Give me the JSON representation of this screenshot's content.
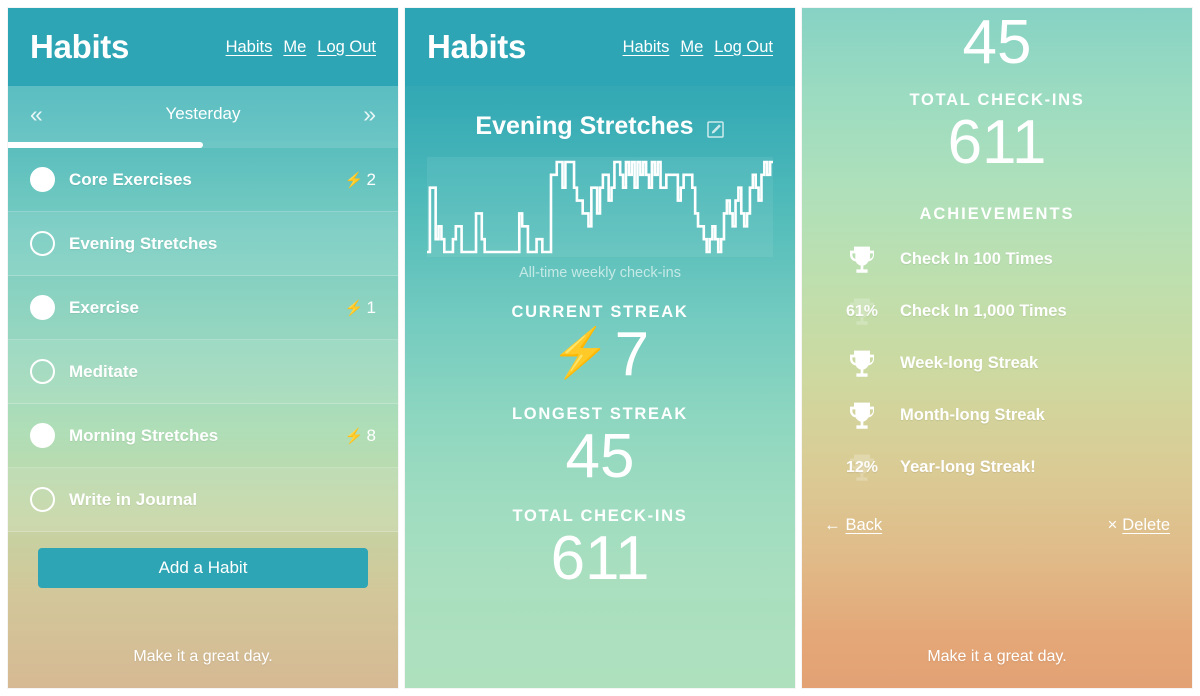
{
  "brand": "Habits",
  "nav": {
    "habits": "Habits",
    "me": "Me",
    "logout": "Log Out"
  },
  "panel1": {
    "date_label": "Yesterday",
    "prev_icon": "«",
    "next_icon": "»",
    "progress_percent": 50,
    "bolt_glyph": "⚡",
    "habits": [
      {
        "name": "Core Exercises",
        "done": true,
        "streak": "2"
      },
      {
        "name": "Evening Stretches",
        "done": false,
        "streak": ""
      },
      {
        "name": "Exercise",
        "done": true,
        "streak": "1"
      },
      {
        "name": "Meditate",
        "done": false,
        "streak": ""
      },
      {
        "name": "Morning Stretches",
        "done": true,
        "streak": "8"
      },
      {
        "name": "Write in Journal",
        "done": false,
        "streak": ""
      }
    ],
    "add_label": "Add a Habit",
    "footer": "Make it a great day."
  },
  "panel2": {
    "habit_title": "Evening Stretches",
    "edit_icon": "edit-pencil-icon",
    "chart_caption": "All-time weekly check-ins",
    "current_streak_label": "CURRENT STREAK",
    "current_streak_value": "7",
    "bolt_glyph": "⚡",
    "longest_streak_label": "LONGEST STREAK",
    "longest_streak_value": "45",
    "total_checkins_label": "TOTAL CHECK-INS",
    "total_checkins_value": "611"
  },
  "panel3": {
    "longest_streak_value": "45",
    "total_checkins_label": "TOTAL CHECK-INS",
    "total_checkins_value": "611",
    "achievements_label": "ACHIEVEMENTS",
    "achievements": [
      {
        "name": "Check In 100 Times",
        "earned": true,
        "percent": ""
      },
      {
        "name": "Check In 1,000 Times",
        "earned": false,
        "percent": "61%"
      },
      {
        "name": "Week-long Streak",
        "earned": true,
        "percent": ""
      },
      {
        "name": "Month-long Streak",
        "earned": true,
        "percent": ""
      },
      {
        "name": "Year-long Streak!",
        "earned": false,
        "percent": "12%"
      }
    ],
    "back_label": "Back",
    "back_arrow": "←",
    "delete_label": "Delete",
    "delete_mark": "×",
    "footer": "Make it a great day."
  },
  "colors": {
    "brand_teal": "#2da5b4",
    "white": "#ffffff",
    "sand": "#d6b994",
    "orange": "#e3a174"
  },
  "chart_data": {
    "type": "line",
    "title": "",
    "xlabel": "",
    "ylabel": "",
    "caption": "All-time weekly check-ins",
    "grid": false,
    "legend": "none",
    "ylim": [
      0,
      7
    ],
    "x": [
      0,
      1,
      2,
      3,
      4,
      5,
      6,
      7,
      8,
      9,
      10,
      11,
      12,
      13,
      14,
      15,
      16,
      17,
      18,
      19,
      20,
      21,
      22,
      23,
      24,
      25,
      26,
      27,
      28,
      29,
      30,
      31,
      32,
      33,
      34,
      35,
      36,
      37,
      38,
      39,
      40,
      41,
      42,
      43,
      44,
      45,
      46,
      47,
      48,
      49,
      50,
      51,
      52,
      53,
      54,
      55,
      56,
      57,
      58,
      59,
      60,
      61,
      62,
      63,
      64,
      65,
      66,
      67,
      68,
      69,
      70,
      71,
      72,
      73,
      74,
      75,
      76,
      77,
      78,
      79,
      80,
      81,
      82,
      83,
      84,
      85,
      86,
      87,
      88,
      89,
      90,
      91,
      92,
      93,
      94,
      95,
      96,
      97,
      98,
      99,
      100,
      101,
      102,
      103,
      104,
      105,
      106,
      107,
      108,
      109,
      110,
      111,
      112,
      113,
      114,
      115,
      116,
      117,
      118,
      119
    ],
    "values": [
      0,
      5,
      5,
      1,
      2,
      1,
      0,
      0,
      0,
      1,
      2,
      2,
      0,
      0,
      0,
      0,
      0,
      3,
      3,
      1,
      0,
      0,
      0,
      0,
      0,
      0,
      0,
      0,
      0,
      0,
      0,
      0,
      3,
      2,
      2,
      0,
      0,
      0,
      1,
      1,
      0,
      0,
      0,
      6,
      6,
      7,
      7,
      5,
      7,
      7,
      7,
      5,
      4,
      4,
      3,
      3,
      2,
      5,
      5,
      3,
      5,
      6,
      6,
      4,
      5,
      7,
      7,
      6,
      5,
      7,
      6,
      7,
      5,
      7,
      6,
      7,
      6,
      5,
      7,
      6,
      7,
      5,
      5,
      6,
      6,
      6,
      6,
      4,
      5,
      6,
      6,
      6,
      5,
      3,
      2,
      2,
      1,
      0,
      1,
      2,
      1,
      0,
      1,
      3,
      4,
      3,
      2,
      4,
      5,
      3,
      2,
      3,
      5,
      6,
      5,
      4,
      6,
      7,
      6,
      7
    ]
  }
}
